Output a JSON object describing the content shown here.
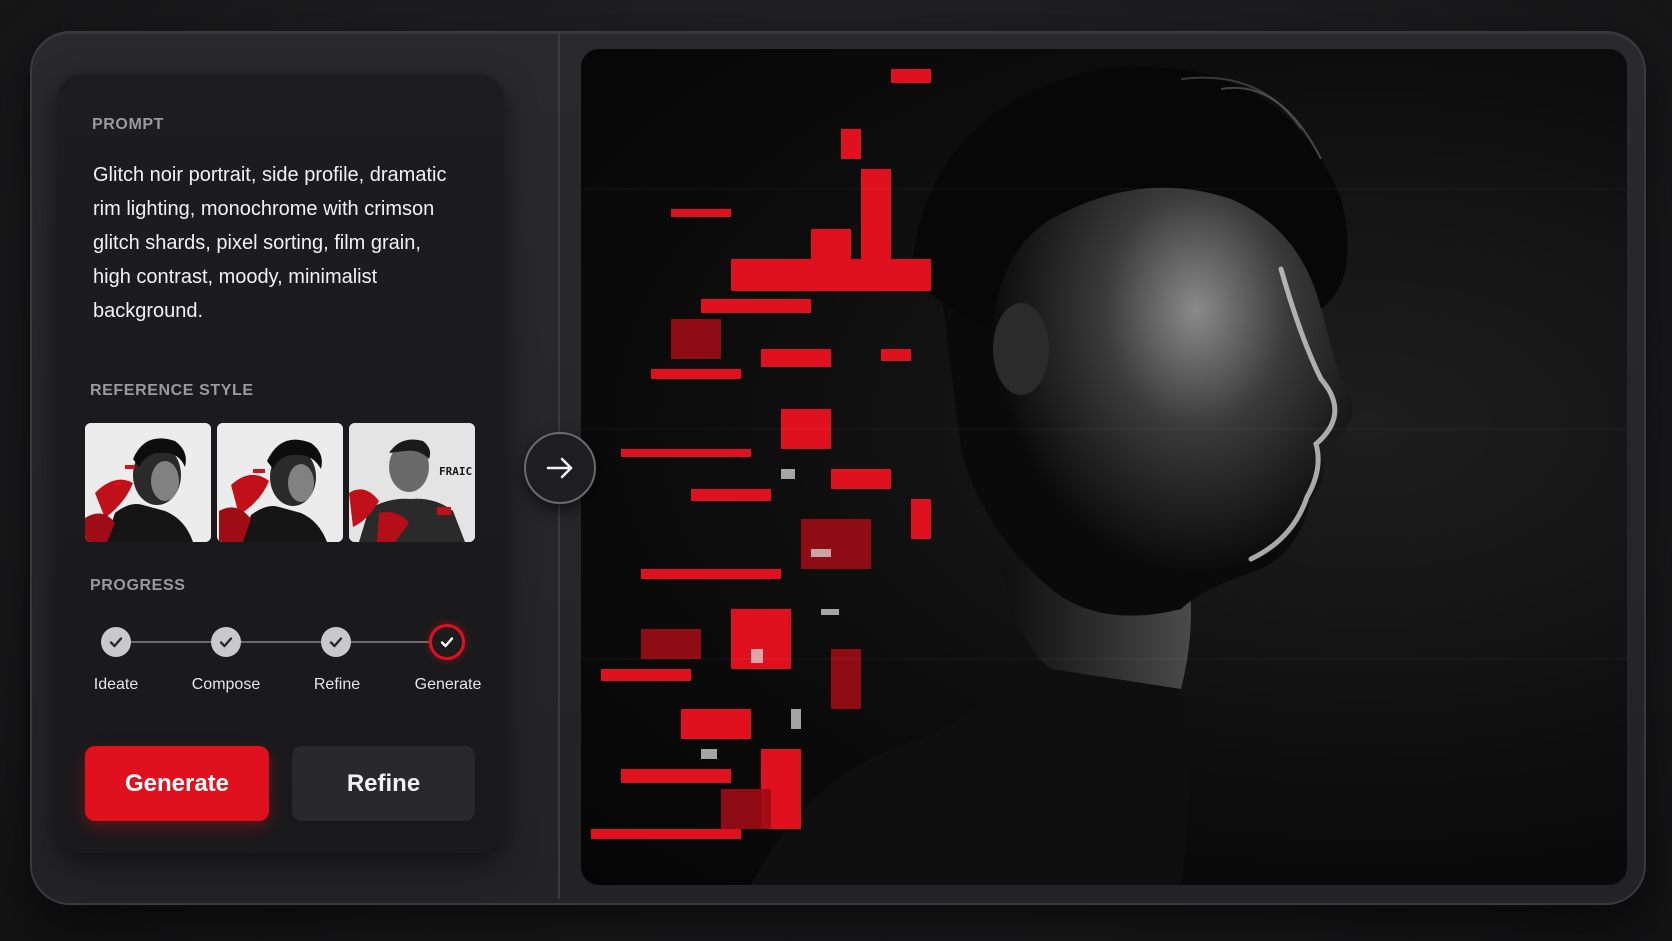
{
  "prompt": {
    "label": "PROMPT",
    "text": "Glitch noir portrait, side profile, dramatic rim lighting, monochrome with crimson glitch shards, pixel sorting, film grain, high contrast, moody, minimalist background."
  },
  "reference_style": {
    "label": "REFERENCE STYLE",
    "thumbnails": [
      {
        "icon": "portrait-thumbnail-1"
      },
      {
        "icon": "portrait-thumbnail-2"
      },
      {
        "icon": "portrait-thumbnail-3",
        "caption": "FRAIC"
      }
    ]
  },
  "progress": {
    "label": "PROGRESS",
    "steps": [
      {
        "label": "Ideate",
        "state": "done"
      },
      {
        "label": "Compose",
        "state": "done"
      },
      {
        "label": "Refine",
        "state": "done"
      },
      {
        "label": "Generate",
        "state": "active"
      }
    ]
  },
  "actions": {
    "generate_label": "Generate",
    "refine_label": "Refine"
  },
  "colors": {
    "accent": "#e0111e",
    "panel": "#1d1d1f",
    "background": "#1b1b1c"
  },
  "icons": {
    "arrow": "arrow-right-icon",
    "check": "check-icon"
  }
}
